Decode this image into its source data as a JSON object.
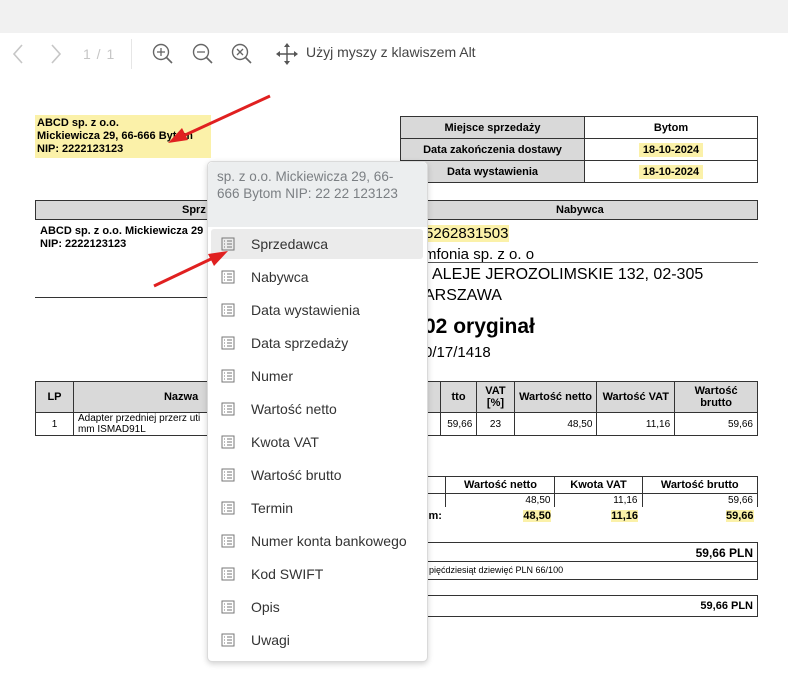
{
  "toolbar": {
    "page_indicator": "1 / 1",
    "alt_hint": "Użyj myszy z klawiszem Alt"
  },
  "invoice": {
    "seller_box": [
      "ABCD sp. z o.o.",
      "Mickiewicza 29, 66-666 Bytom",
      "NIP: 2222123123"
    ],
    "meta": [
      {
        "label": "Miejsce sprzedaży",
        "value": "Bytom"
      },
      {
        "label": "Data zakończenia dostawy",
        "value": "18-10-2024"
      },
      {
        "label": "Data wystawienia",
        "value": "18-10-2024"
      }
    ],
    "seller_header": "Sprz",
    "buyer_header": "Nabywca",
    "seller_lines": [
      "ABCD sp. z o.o. Mickiewicza 29",
      "NIP: 2222123123"
    ],
    "buyer_nip": "5262831503",
    "buyer_name": "mfonia sp. z o. o",
    "buyer_addr1": ". ALEJE JEROZOLIMSKIE 132, 02-305",
    "buyer_addr2": "ARSZAWA",
    "title": "02 oryginał",
    "subtitle": "0/17/1418",
    "items_headers": [
      "LP",
      "Nazwa",
      "tto",
      "VAT [%]",
      "Wartość netto",
      "Wartość VAT",
      "Wartość brutto"
    ],
    "item_row": {
      "lp": "1",
      "name1": "Adapter przedniej przerz uti",
      "name2": "mm ISMAD91L",
      "price": "59,66",
      "vat": "23",
      "netto": "48,50",
      "vat_val": "11,16",
      "brutto": "59,66"
    },
    "sum_headers": [
      "Wartość netto",
      "Kwota VAT",
      "Wartość brutto"
    ],
    "sum_row": [
      "48,50",
      "11,16",
      "59,66"
    ],
    "sum_total_label": "m:",
    "sum_total": [
      "48,50",
      "11,16",
      "59,66"
    ],
    "to_pay": "59,66 PLN",
    "in_words": "pięćdziesiąt dziewięć PLN 66/100",
    "to_pay2": "59,66 PLN"
  },
  "context_menu": {
    "header": "sp. z o.o. Mickiewicza 29, 66-666 Bytom NIP: 22 22 123123",
    "items": [
      "Sprzedawca",
      "Nabywca",
      "Data wystawienia",
      "Data sprzedaży",
      "Numer",
      "Wartość netto",
      "Kwota VAT",
      "Wartość brutto",
      "Termin",
      "Numer konta bankowego",
      "Kod SWIFT",
      "Opis",
      "Uwagi"
    ],
    "active_index": 0
  },
  "colors": {
    "highlight": "#fbf1a9",
    "arrow": "#e02020",
    "header_gray": "#d9d9d9"
  }
}
